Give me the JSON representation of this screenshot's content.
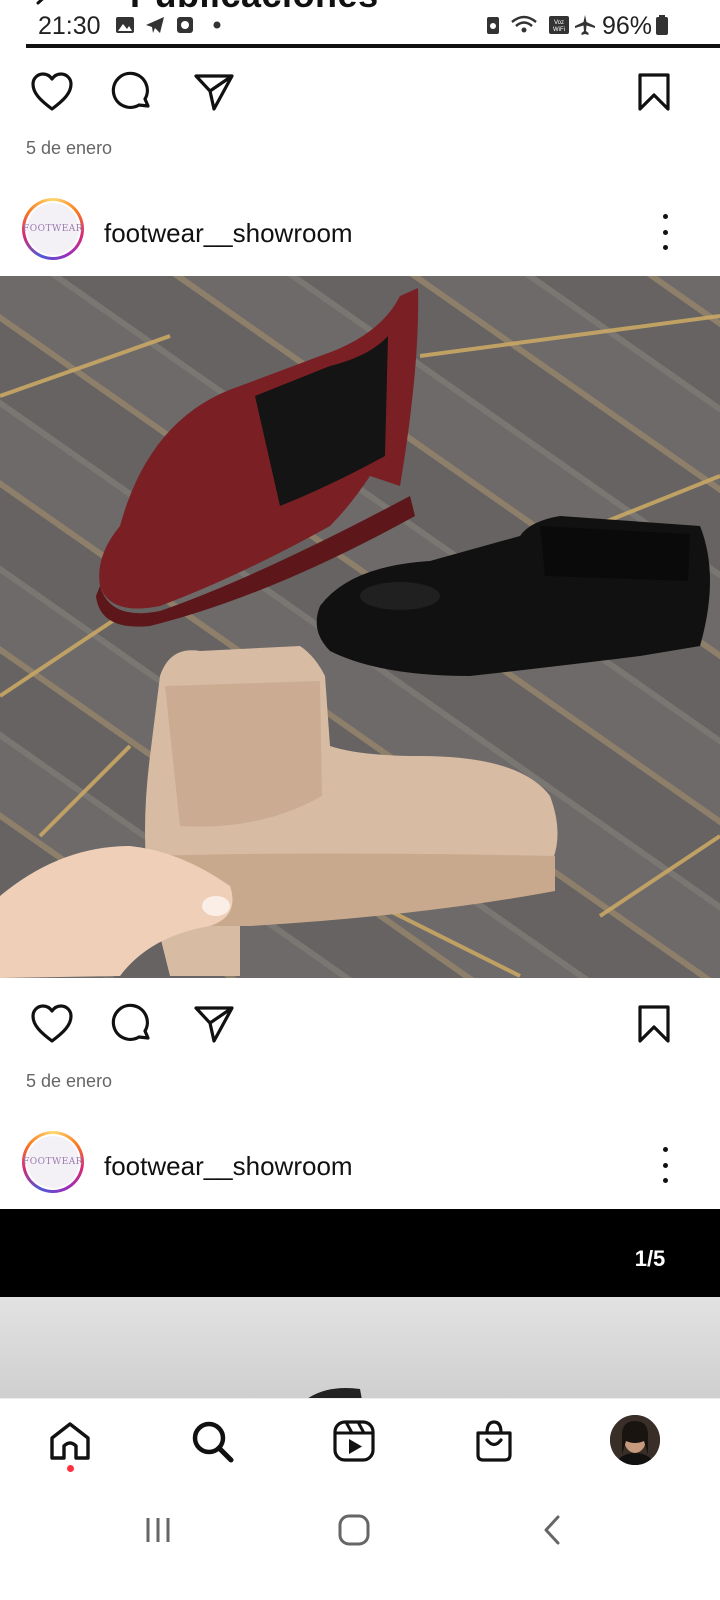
{
  "page": {
    "title_partial": "Publicaciones"
  },
  "status_bar": {
    "time": "21:30",
    "battery": "96%",
    "icons": [
      "image-icon",
      "telegram-icon",
      "app-icon",
      "dot-icon",
      "battery-saver-icon",
      "wifi-icon",
      "voz-wifi-icon",
      "airplane-icon",
      "battery-icon"
    ]
  },
  "posts": [
    {
      "date": "5 de enero",
      "username": "footwear__showroom",
      "avatar_text": "FOOTWEAR"
    },
    {
      "date": "5 de enero",
      "username": "footwear__showroom",
      "avatar_text": "FOOTWEAR",
      "carousel_counter": "1/5"
    }
  ],
  "bottom_nav": {
    "items": [
      "home",
      "search",
      "reels",
      "shop",
      "profile"
    ]
  },
  "colors": {
    "notification_dot": "#ff3040",
    "text": "#111111",
    "muted": "#666666"
  }
}
